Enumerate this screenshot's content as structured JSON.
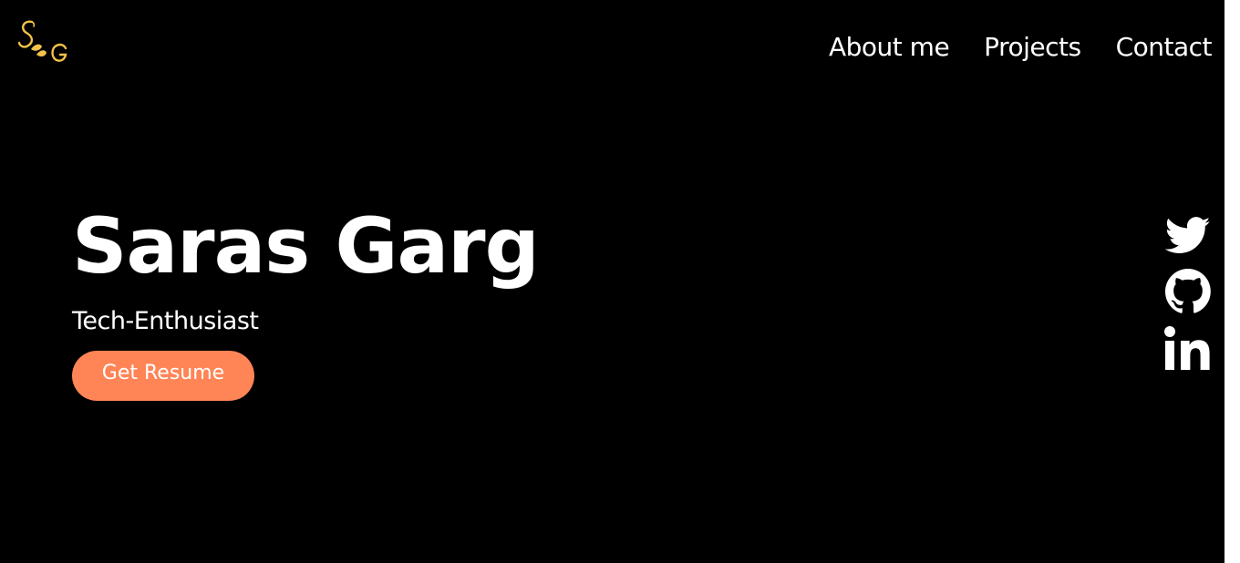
{
  "brand": {
    "logo_text": "SG",
    "logo_color": "#f3c24a"
  },
  "nav": {
    "items": [
      {
        "label": "About me"
      },
      {
        "label": "Projects"
      },
      {
        "label": "Contact"
      }
    ]
  },
  "hero": {
    "name": "Saras Garg",
    "tagline": "Tech-Enthusiast",
    "resume_label": "Get Resume",
    "button_color": "#ff8456"
  },
  "social": {
    "icons": [
      "twitter-icon",
      "github-icon",
      "linkedin-icon"
    ]
  },
  "colors": {
    "background": "#000000",
    "text": "#ffffff"
  }
}
